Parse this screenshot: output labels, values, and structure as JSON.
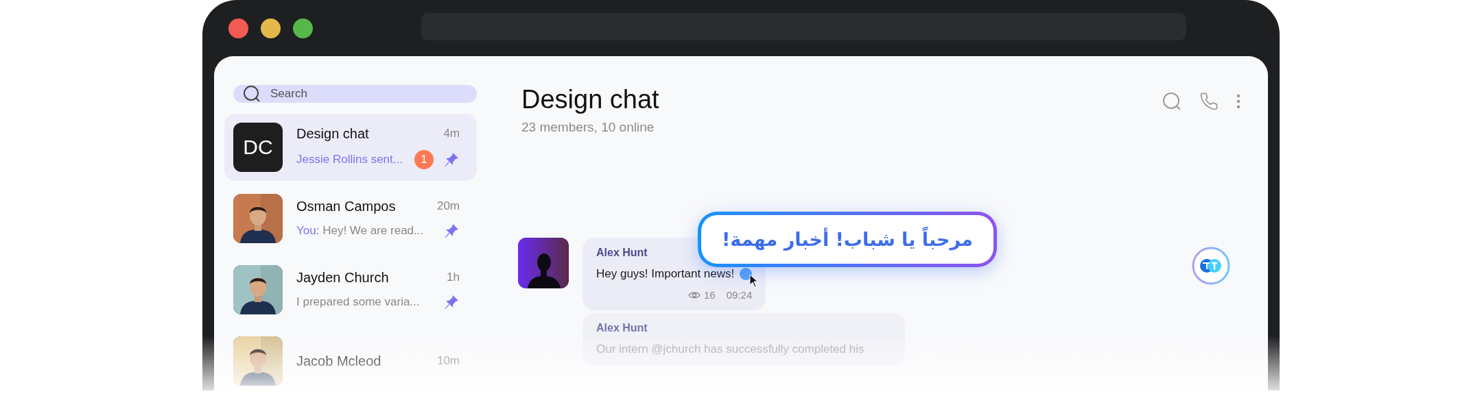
{
  "search": {
    "placeholder": "Search"
  },
  "chats": [
    {
      "name": "Design chat",
      "time": "4m",
      "avatar": {
        "kind": "initials",
        "text": "DC"
      },
      "preview": "Jessie Rollins sent...",
      "unread": "1",
      "pinned": true,
      "selected": true
    },
    {
      "name": "Osman Campos",
      "time": "20m",
      "sender": "You:",
      "preview": "Hey! We are read...",
      "pinned": true,
      "selected": false
    },
    {
      "name": "Jayden Church",
      "time": "1h",
      "preview": "I prepared some varia...",
      "pinned": true,
      "selected": false
    },
    {
      "name": "Jacob Mcleod",
      "time": "10m",
      "selected": false
    }
  ],
  "header": {
    "title": "Design chat",
    "subtitle": "23 members, 10 online"
  },
  "messages": [
    {
      "author": "Alex Hunt",
      "text": "Hey guys! Important news!",
      "views": "16",
      "time": "09:24",
      "translating": true,
      "avatar": true
    },
    {
      "author": "Alex Hunt",
      "text": "Our intern @jchurch has successfully completed his",
      "avatar": false
    }
  ],
  "translation": {
    "text": "مرحباً يا شباب! أخبار مهمة!"
  }
}
